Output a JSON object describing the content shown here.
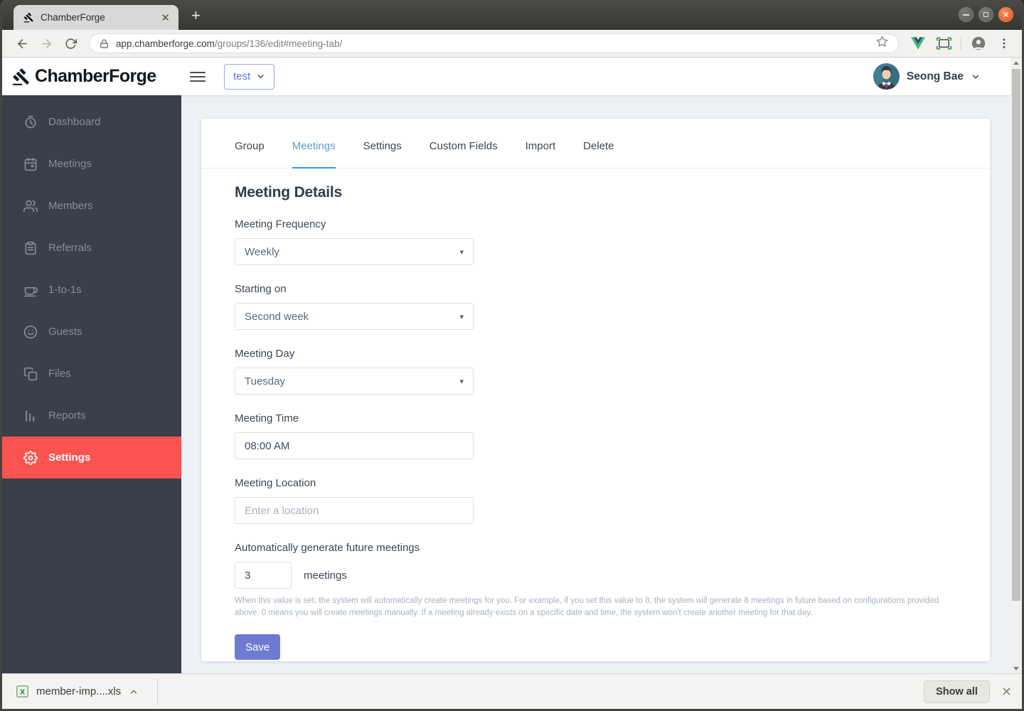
{
  "browser": {
    "tab_title": "ChamberForge",
    "new_tab_glyph": "+",
    "url_host": "app.chamberforge.com",
    "url_path": "/groups/136/edit#meeting-tab/"
  },
  "header": {
    "logo_text": "ChamberForge",
    "group_selector_value": "test",
    "user_name": "Seong Bae"
  },
  "sidebar": {
    "items": [
      {
        "label": "Dashboard",
        "icon": "clock-icon",
        "active": false
      },
      {
        "label": "Meetings",
        "icon": "calendar-icon",
        "active": false
      },
      {
        "label": "Members",
        "icon": "users-icon",
        "active": false
      },
      {
        "label": "Referrals",
        "icon": "clipboard-icon",
        "active": false
      },
      {
        "label": "1-to-1s",
        "icon": "coffee-icon",
        "active": false
      },
      {
        "label": "Guests",
        "icon": "smile-icon",
        "active": false
      },
      {
        "label": "Files",
        "icon": "copy-icon",
        "active": false
      },
      {
        "label": "Reports",
        "icon": "bar-chart-icon",
        "active": false
      },
      {
        "label": "Settings",
        "icon": "gear-icon",
        "active": true
      }
    ]
  },
  "tabs": {
    "items": [
      {
        "label": "Group",
        "active": false
      },
      {
        "label": "Meetings",
        "active": true
      },
      {
        "label": "Settings",
        "active": false
      },
      {
        "label": "Custom Fields",
        "active": false
      },
      {
        "label": "Import",
        "active": false
      },
      {
        "label": "Delete",
        "active": false
      }
    ]
  },
  "form": {
    "title": "Meeting Details",
    "frequency": {
      "label": "Meeting Frequency",
      "value": "Weekly"
    },
    "starting": {
      "label": "Starting on",
      "value": "Second week"
    },
    "day": {
      "label": "Meeting Day",
      "value": "Tuesday"
    },
    "time": {
      "label": "Meeting Time",
      "value": "08:00 AM"
    },
    "location": {
      "label": "Meeting Location",
      "placeholder": "Enter a location"
    },
    "autogen": {
      "label": "Automatically generate future meetings",
      "value": "3",
      "suffix": "meetings",
      "help": "When this value is set, the system will automatically create meetings for you. For example, if you set this value to 8, the system will generate 8 meetings in future based on configurations provided above. 0 means you will create meetings manually. If a meeting already exists on a specific date and time, the system won't create another meeting for that day."
    },
    "save_label": "Save"
  },
  "download_bar": {
    "file_name": "member-imp....xls",
    "show_all_label": "Show all"
  },
  "colors": {
    "sidebar_bg": "#3a4049",
    "accent_red": "#fb534f",
    "save_indigo": "#6f7bd3",
    "active_tab_blue": "#2d9ce3",
    "close_button_orange": "#e94e22"
  }
}
